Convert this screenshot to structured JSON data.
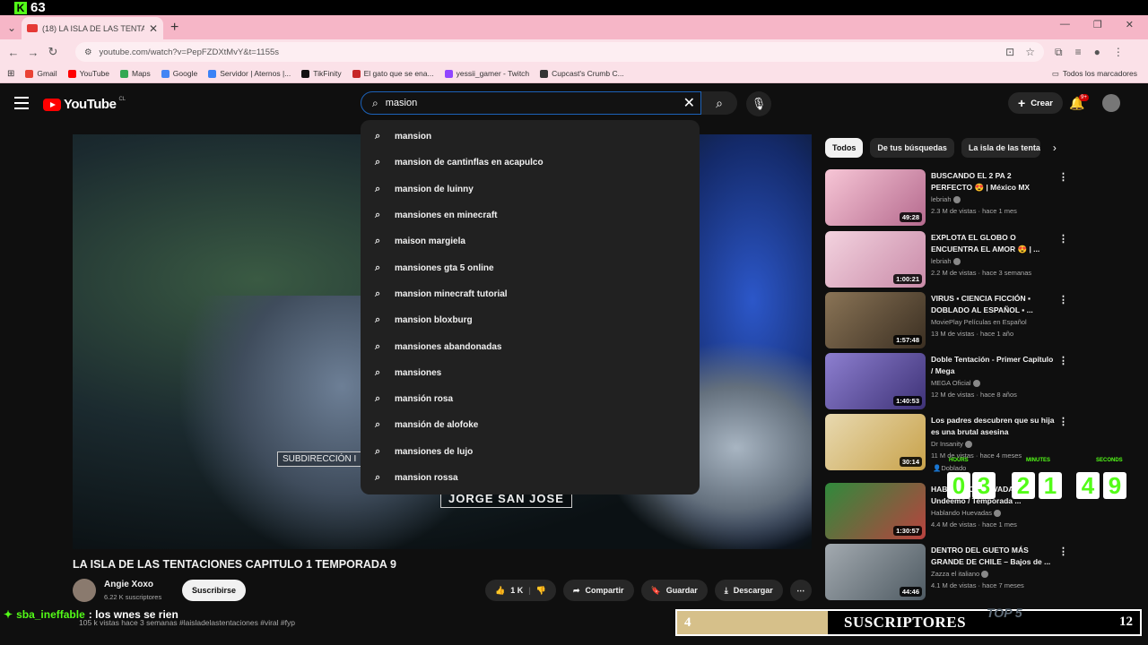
{
  "stream": {
    "viewer_count": "63",
    "logo_letter": "K"
  },
  "browser": {
    "tab_title": "(18) LA ISLA DE LAS TENTACIO",
    "url": "youtube.com/watch?v=PepFZDXtMvY&t=1155s",
    "bookmarks": [
      {
        "label": "Gmail",
        "color": "#ea4335"
      },
      {
        "label": "YouTube",
        "color": "#ff0000"
      },
      {
        "label": "Maps",
        "color": "#34a853"
      },
      {
        "label": "Google",
        "color": "#4285f4"
      },
      {
        "label": "Servidor | Aternos |...",
        "color": "#3b82f6"
      },
      {
        "label": "TikFinity",
        "color": "#111111"
      },
      {
        "label": "El gato que se ena...",
        "color": "#c62828"
      },
      {
        "label": "yessii_gamer - Twitch",
        "color": "#9146ff"
      },
      {
        "label": "Cupcast's Crumb C...",
        "color": "#333333"
      }
    ],
    "all_bookmarks": "Todos los marcadores"
  },
  "youtube": {
    "logo_text": "YouTube",
    "country": "CL",
    "search_value": "masion",
    "create_label": "Crear",
    "notif_badge": "9+"
  },
  "suggestions": [
    "mansion",
    "mansion de cantinflas en acapulco",
    "mansion de luinny",
    "mansiones en minecraft",
    "maison margiela",
    "mansiones gta 5 online",
    "mansion minecraft tutorial",
    "mansion bloxburg",
    "mansiones abandonadas",
    "mansiones",
    "mansión rosa",
    "mansión de alofoke",
    "mansiones de lujo",
    "mansion rossa"
  ],
  "video": {
    "caption_sub": "SUBDIRECCIÓN I",
    "caption_name": "JORGE SAN JOSE",
    "title": "LA ISLA DE LAS TENTACIONES CAPITULO 1 TEMPORADA 9",
    "channel": "Angie Xoxo",
    "subscribers": "6.22 K suscriptores",
    "subscribe_label": "Suscribirse",
    "likes": "1 K",
    "share_label": "Compartir",
    "save_label": "Guardar",
    "download_label": "Descargar",
    "description": "105 k vistas  hace 3 semanas  #laisladelastentaciones #viral #fyp"
  },
  "chips": [
    "Todos",
    "De tus búsquedas",
    "La isla de las tentac"
  ],
  "recommendations": [
    {
      "title": "BUSCANDO EL 2 PA 2 PERFECTO 😍 | México MX",
      "channel": "lebriah",
      "meta": "2.3 M de vistas · hace 1 mes",
      "duration": "49:28",
      "thumb_color": "#b56a8e"
    },
    {
      "title": "EXPLOTA EL GLOBO O ENCUENTRA EL AMOR 😍 | ...",
      "channel": "lebriah",
      "meta": "2.2 M de vistas · hace 3 semanas",
      "duration": "1:00:21",
      "thumb_color": "#c98aa8"
    },
    {
      "title": "VIRUS ▪ CIENCIA FICCIÓN ▪ DOBLADO AL ESPAÑOL ▪ ...",
      "channel": "MoviePlay Películas en Español",
      "meta": "13 M de vistas · hace 1 año",
      "duration": "1:57:48",
      "thumb_color": "#5a4a36"
    },
    {
      "title": "Doble Tentación - Primer Capítulo / Mega",
      "channel": "MEGA Oficial",
      "meta": "12 M de vistas · hace 8 años",
      "duration": "1:40:53",
      "thumb_color": "#6b5aa8"
    },
    {
      "title": "Los padres descubren que su hija es una brutal asesina",
      "channel": "Dr Insanity",
      "meta": "11 M de vistas · hace 4 meses",
      "duration": "30:14",
      "thumb_color": "#c8a24a"
    },
    {
      "title": "HABLANDO HUEVADAS Undeemo / Temporada ...",
      "channel": "Hablando Huevadas",
      "meta": "4.4 M de vistas · hace 1 mes",
      "duration": "1:30:57",
      "thumb_color": "#2f8a3c"
    },
    {
      "title": "DENTRO DEL GUETO MÁS GRANDE DE CHILE – Bajos de ...",
      "channel": "Zazza el italiano",
      "meta": "4.1 M de vistas · hace 7 meses",
      "duration": "44:46",
      "thumb_color": "#6e7a82"
    }
  ],
  "dubbed_label": "Doblado",
  "timer": {
    "hours_label": "HOURS",
    "minutes_label": "MINUTES",
    "seconds_label": "SECONDS",
    "hours": [
      "0",
      "3"
    ],
    "minutes": [
      "2",
      "1"
    ],
    "seconds": [
      "4",
      "9"
    ]
  },
  "chat": {
    "user": "sba_ineffable",
    "message": ": los wnes se rien"
  },
  "sub_goal": {
    "current": "4",
    "label": "SUSCRIPTORES",
    "total": "12",
    "badge": "TOP 5"
  }
}
